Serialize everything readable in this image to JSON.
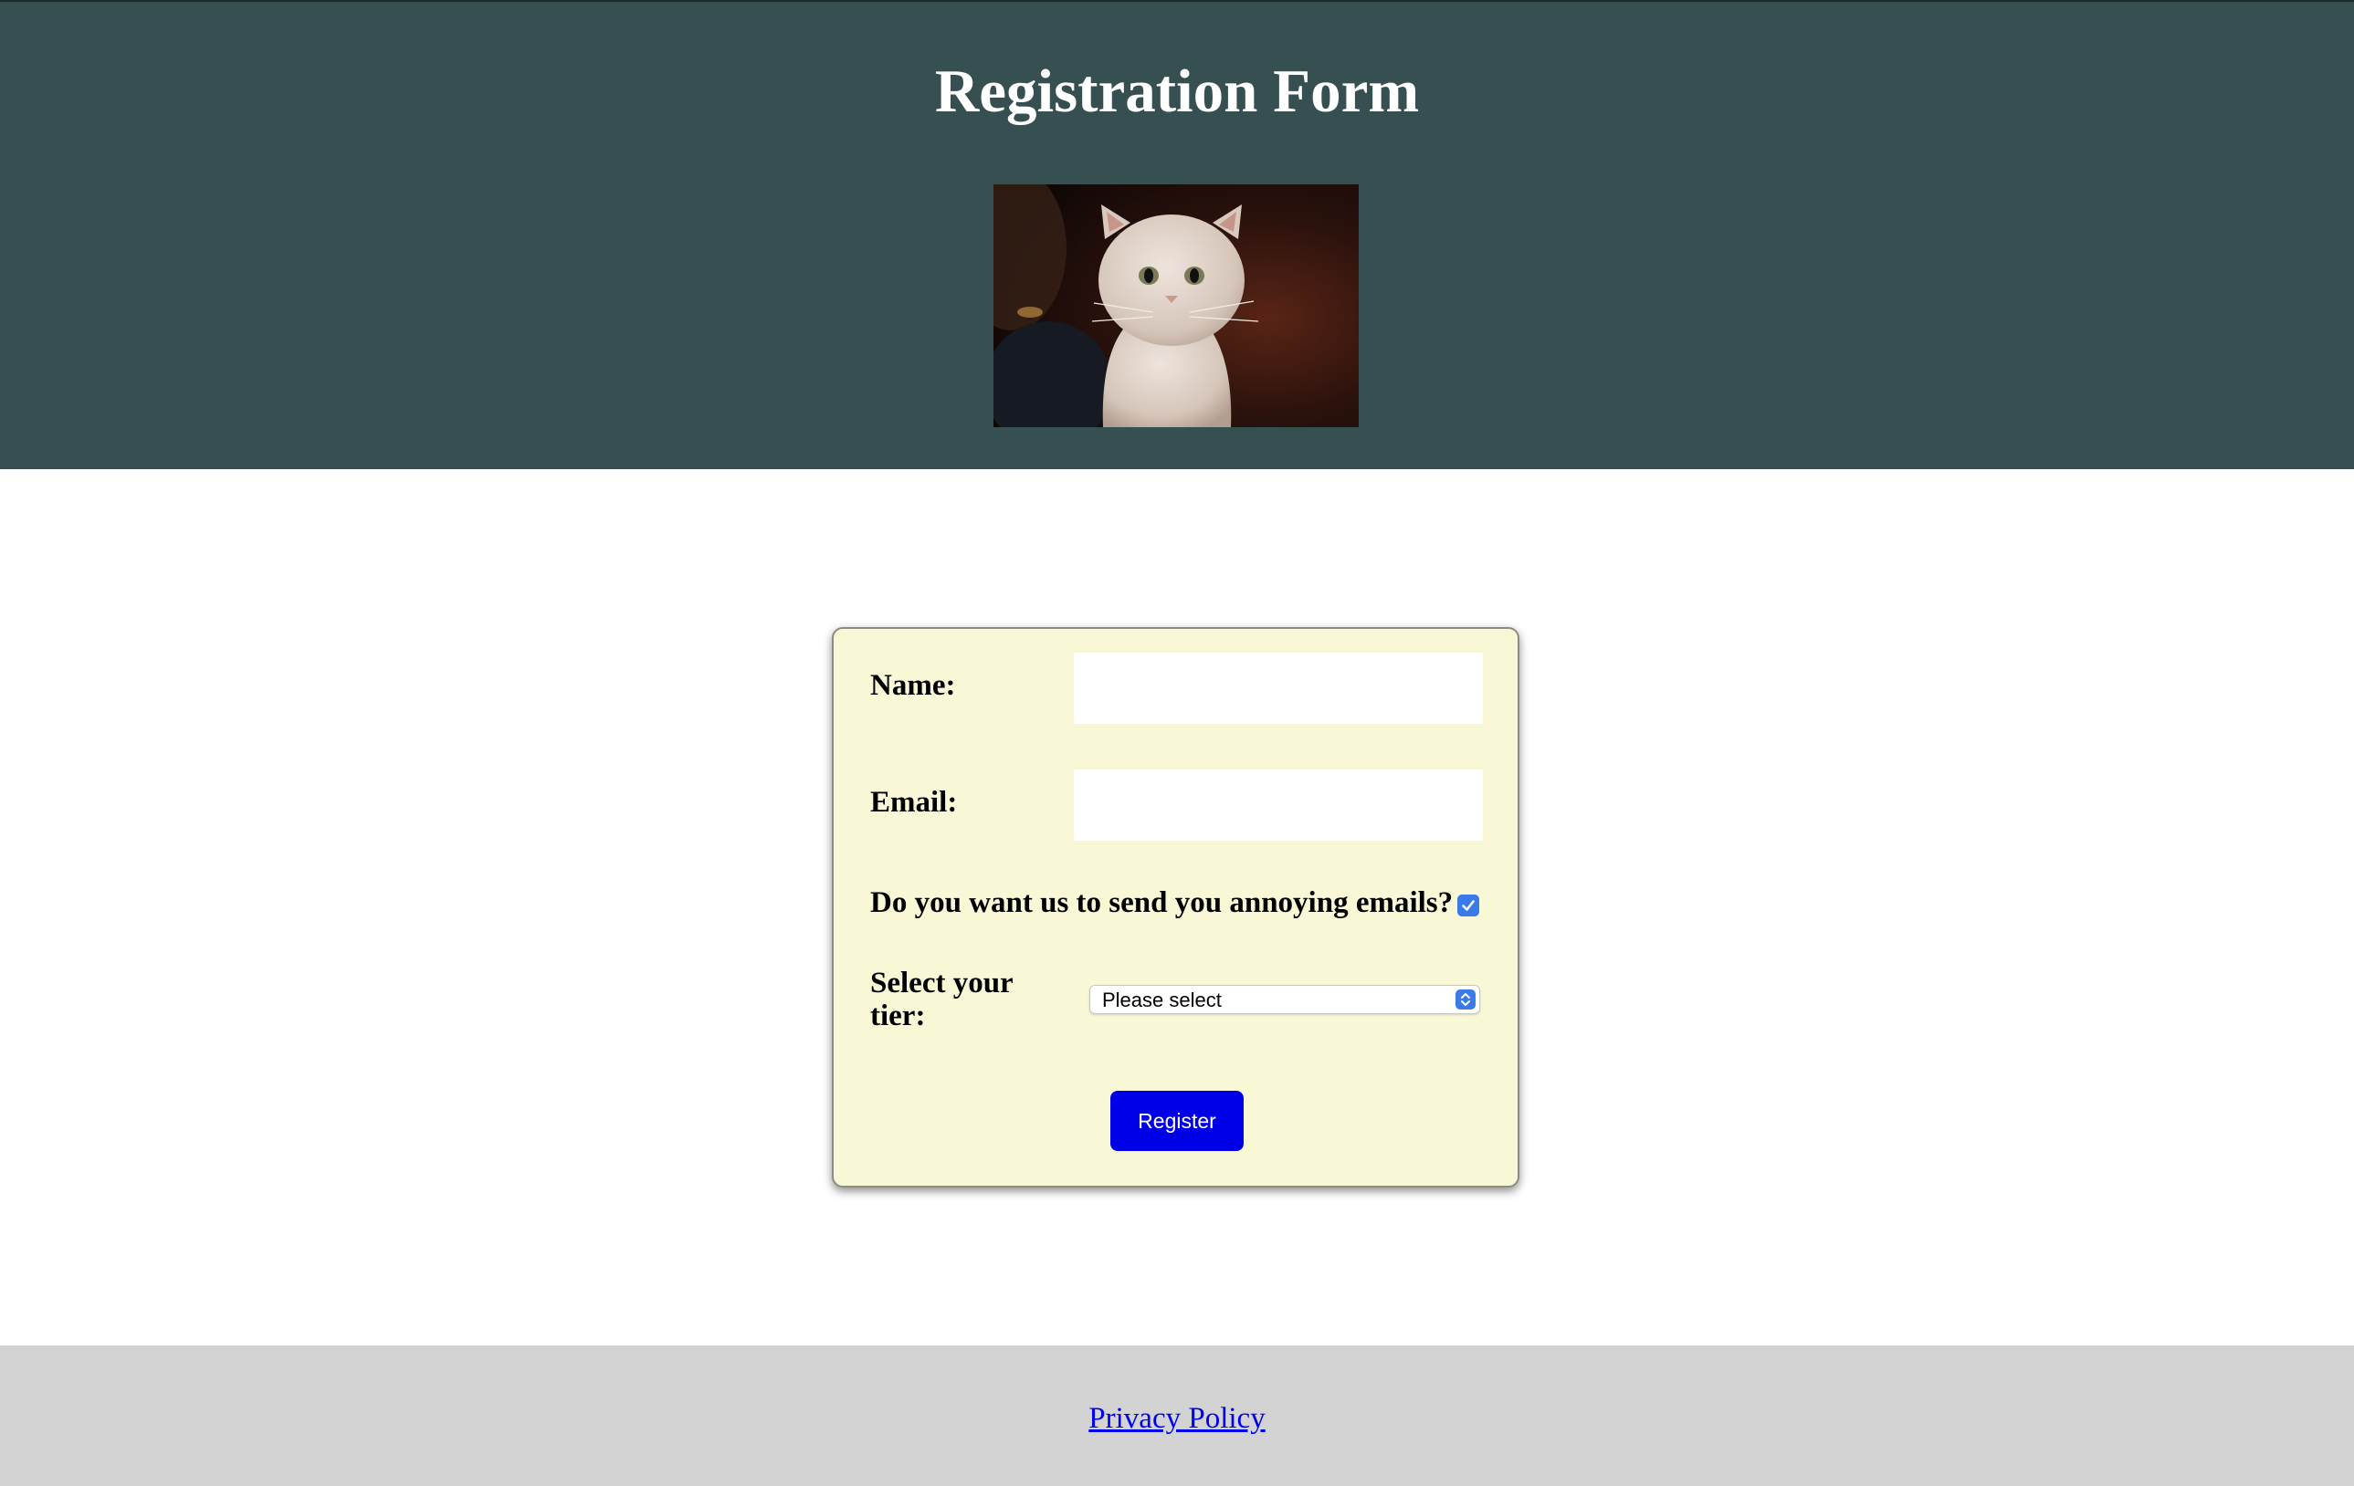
{
  "header": {
    "title": "Registration Form",
    "background_color": "#364f51",
    "image": {
      "subject": "cream-colored kitten looking up",
      "icon": "kitten-photo"
    }
  },
  "form": {
    "background_color": "#f8f8d6",
    "name": {
      "label": "Name:",
      "value": ""
    },
    "email": {
      "label": "Email:",
      "value": ""
    },
    "annoying_emails": {
      "label": "Do you want us to send you annoying emails?",
      "checked": true,
      "icon": "checkmark-icon"
    },
    "tier": {
      "label": "Select your tier:",
      "selected": "Please select",
      "icon": "select-arrows-icon"
    },
    "submit": {
      "label": "Register",
      "color": "#0000e6"
    }
  },
  "footer": {
    "background_color": "#d3d3d3",
    "link_label": "Privacy Policy",
    "link_color": "#0000ee"
  }
}
